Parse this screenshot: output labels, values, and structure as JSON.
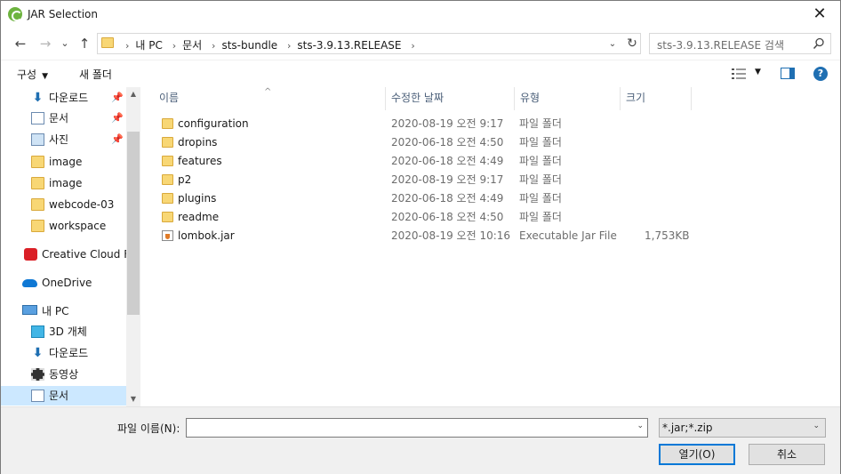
{
  "window": {
    "title": "JAR Selection",
    "close": "✕"
  },
  "nav": {
    "back": "←",
    "forward": "→",
    "recent": "⌄",
    "up": "↑"
  },
  "address": {
    "breadcrumbs": [
      "내 PC",
      "문서",
      "sts-bundle",
      "sts-3.9.13.RELEASE"
    ],
    "separator": "›",
    "dropdown": "⌄",
    "refresh": "↻"
  },
  "search": {
    "placeholder": "sts-3.9.13.RELEASE 검색"
  },
  "toolbar": {
    "organize": "구성",
    "organize_caret": "▼",
    "new_folder": "새 폴더",
    "view_caret": "▼",
    "help": "?"
  },
  "sidebar": {
    "items": [
      {
        "label": "다운로드",
        "icon": "download-arrow-icon",
        "pinned": true
      },
      {
        "label": "문서",
        "icon": "document-icon",
        "pinned": true
      },
      {
        "label": "사진",
        "icon": "pictures-icon",
        "pinned": true
      },
      {
        "label": "image",
        "icon": "folder-icon"
      },
      {
        "label": "image",
        "icon": "folder-icon"
      },
      {
        "label": "webcode-03",
        "icon": "folder-icon"
      },
      {
        "label": "workspace",
        "icon": "folder-icon"
      },
      {
        "label": "Creative Cloud Fil",
        "icon": "creative-cloud-icon"
      },
      {
        "label": "OneDrive",
        "icon": "onedrive-cloud-icon"
      },
      {
        "label": "내 PC",
        "icon": "computer-icon"
      },
      {
        "label": "3D 개체",
        "icon": "3d-cube-icon"
      },
      {
        "label": "다운로드",
        "icon": "download-arrow-icon"
      },
      {
        "label": "동영상",
        "icon": "film-icon"
      },
      {
        "label": "문서",
        "icon": "document-icon",
        "selected": true
      }
    ],
    "pin_glyph": "📌",
    "scroll_up": "▲",
    "scroll_down": "▼"
  },
  "filelist": {
    "columns": [
      "이름",
      "수정한 날짜",
      "유형",
      "크기"
    ],
    "sort_caret": "^",
    "rows": [
      {
        "name": "configuration",
        "date": "2020-08-19 오전 9:17",
        "type": "파일 폴더",
        "size": "",
        "icon": "folder-icon"
      },
      {
        "name": "dropins",
        "date": "2020-06-18 오전 4:50",
        "type": "파일 폴더",
        "size": "",
        "icon": "folder-icon"
      },
      {
        "name": "features",
        "date": "2020-06-18 오전 4:49",
        "type": "파일 폴더",
        "size": "",
        "icon": "folder-icon"
      },
      {
        "name": "p2",
        "date": "2020-08-19 오전 9:17",
        "type": "파일 폴더",
        "size": "",
        "icon": "folder-icon"
      },
      {
        "name": "plugins",
        "date": "2020-06-18 오전 4:49",
        "type": "파일 폴더",
        "size": "",
        "icon": "folder-icon"
      },
      {
        "name": "readme",
        "date": "2020-06-18 오전 4:50",
        "type": "파일 폴더",
        "size": "",
        "icon": "folder-icon"
      },
      {
        "name": "lombok.jar",
        "date": "2020-08-19 오전 10:16",
        "type": "Executable Jar File",
        "size": "1,753KB",
        "icon": "jar-file-icon"
      }
    ]
  },
  "footer": {
    "filename_label": "파일 이름(N):",
    "filename_value": "",
    "filter_value": "*.jar;*.zip",
    "open_label": "열기(O)",
    "cancel_label": "취소",
    "dropdown_glyph": "⌄"
  },
  "colors": {
    "accent": "#0078d7",
    "selection": "#cce8ff",
    "folder": "#f8d775",
    "header_text": "#4c607a"
  }
}
